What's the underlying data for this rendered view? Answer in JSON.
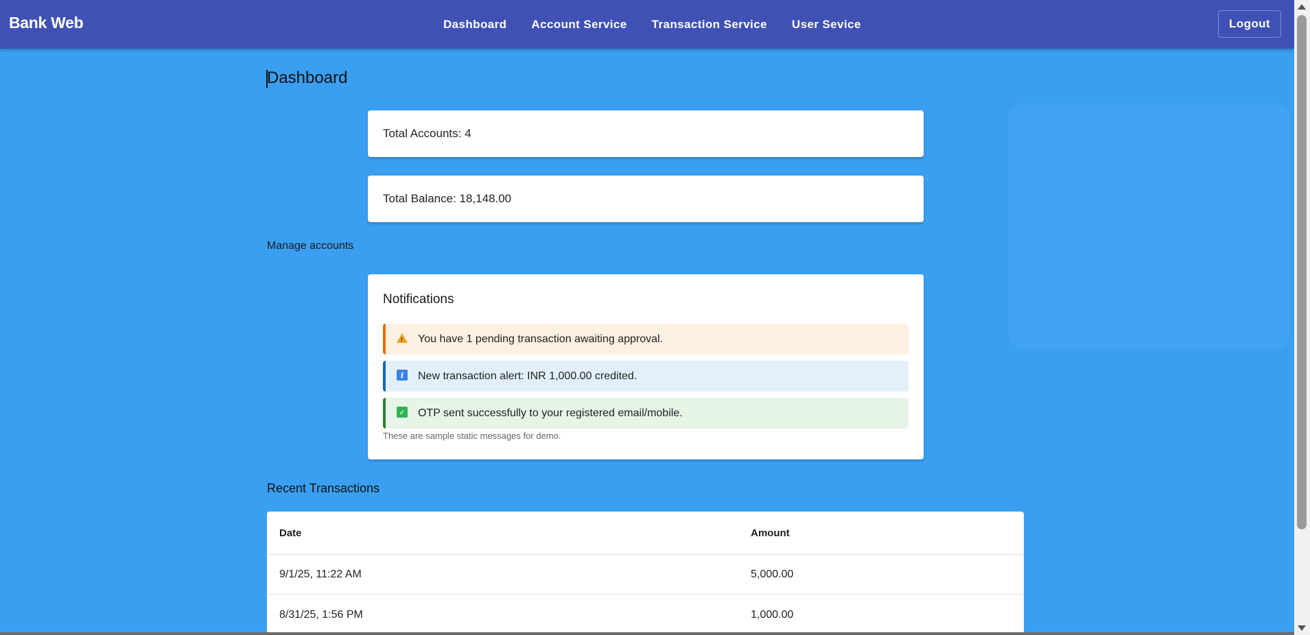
{
  "header": {
    "brand": "Bank Web",
    "nav": [
      "Dashboard",
      "Account Service",
      "Transaction Service",
      "User Sevice"
    ],
    "logout_label": "Logout"
  },
  "page": {
    "title": "Dashboard",
    "manage_accounts_label": "Manage accounts"
  },
  "stats": {
    "total_accounts": "Total Accounts: 4",
    "total_balance": "Total Balance: 18,148.00"
  },
  "notifications": {
    "title": "Notifications",
    "items": [
      {
        "type": "warning",
        "icon": "warning-icon",
        "text": "You have 1 pending transaction awaiting approval.",
        "color": "#ef6c00"
      },
      {
        "type": "info",
        "icon": "info-icon",
        "text": "New transaction alert: INR 1,000.00 credited.",
        "color": "#1565c0"
      },
      {
        "type": "success",
        "icon": "check-icon",
        "text": "OTP sent successfully to your registered email/mobile.",
        "color": "#2e7d32"
      }
    ],
    "footer": "These are sample static messages for demo."
  },
  "transactions": {
    "title": "Recent Transactions",
    "columns": [
      "Date",
      "Amount"
    ],
    "rows": [
      {
        "date": "9/1/25, 11:22 AM",
        "amount": "5,000.00"
      },
      {
        "date": "8/31/25, 1:56 PM",
        "amount": "1,000.00"
      }
    ]
  },
  "colors": {
    "topbar": "#3f51b5",
    "background": "#3a9ff0"
  }
}
